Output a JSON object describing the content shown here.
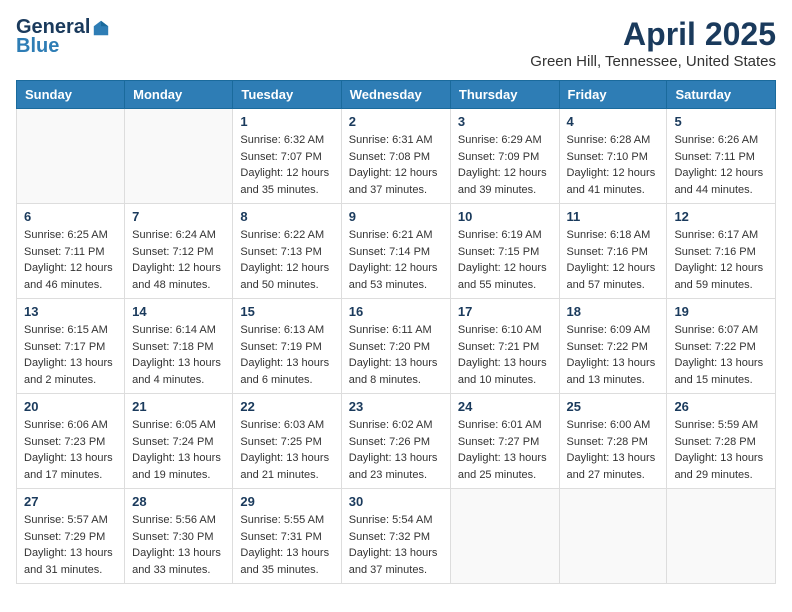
{
  "header": {
    "logo_line1": "General",
    "logo_line2": "Blue",
    "title": "April 2025",
    "subtitle": "Green Hill, Tennessee, United States"
  },
  "days_of_week": [
    "Sunday",
    "Monday",
    "Tuesday",
    "Wednesday",
    "Thursday",
    "Friday",
    "Saturday"
  ],
  "weeks": [
    [
      {
        "day": "",
        "info": ""
      },
      {
        "day": "",
        "info": ""
      },
      {
        "day": "1",
        "info": "Sunrise: 6:32 AM\nSunset: 7:07 PM\nDaylight: 12 hours and 35 minutes."
      },
      {
        "day": "2",
        "info": "Sunrise: 6:31 AM\nSunset: 7:08 PM\nDaylight: 12 hours and 37 minutes."
      },
      {
        "day": "3",
        "info": "Sunrise: 6:29 AM\nSunset: 7:09 PM\nDaylight: 12 hours and 39 minutes."
      },
      {
        "day": "4",
        "info": "Sunrise: 6:28 AM\nSunset: 7:10 PM\nDaylight: 12 hours and 41 minutes."
      },
      {
        "day": "5",
        "info": "Sunrise: 6:26 AM\nSunset: 7:11 PM\nDaylight: 12 hours and 44 minutes."
      }
    ],
    [
      {
        "day": "6",
        "info": "Sunrise: 6:25 AM\nSunset: 7:11 PM\nDaylight: 12 hours and 46 minutes."
      },
      {
        "day": "7",
        "info": "Sunrise: 6:24 AM\nSunset: 7:12 PM\nDaylight: 12 hours and 48 minutes."
      },
      {
        "day": "8",
        "info": "Sunrise: 6:22 AM\nSunset: 7:13 PM\nDaylight: 12 hours and 50 minutes."
      },
      {
        "day": "9",
        "info": "Sunrise: 6:21 AM\nSunset: 7:14 PM\nDaylight: 12 hours and 53 minutes."
      },
      {
        "day": "10",
        "info": "Sunrise: 6:19 AM\nSunset: 7:15 PM\nDaylight: 12 hours and 55 minutes."
      },
      {
        "day": "11",
        "info": "Sunrise: 6:18 AM\nSunset: 7:16 PM\nDaylight: 12 hours and 57 minutes."
      },
      {
        "day": "12",
        "info": "Sunrise: 6:17 AM\nSunset: 7:16 PM\nDaylight: 12 hours and 59 minutes."
      }
    ],
    [
      {
        "day": "13",
        "info": "Sunrise: 6:15 AM\nSunset: 7:17 PM\nDaylight: 13 hours and 2 minutes."
      },
      {
        "day": "14",
        "info": "Sunrise: 6:14 AM\nSunset: 7:18 PM\nDaylight: 13 hours and 4 minutes."
      },
      {
        "day": "15",
        "info": "Sunrise: 6:13 AM\nSunset: 7:19 PM\nDaylight: 13 hours and 6 minutes."
      },
      {
        "day": "16",
        "info": "Sunrise: 6:11 AM\nSunset: 7:20 PM\nDaylight: 13 hours and 8 minutes."
      },
      {
        "day": "17",
        "info": "Sunrise: 6:10 AM\nSunset: 7:21 PM\nDaylight: 13 hours and 10 minutes."
      },
      {
        "day": "18",
        "info": "Sunrise: 6:09 AM\nSunset: 7:22 PM\nDaylight: 13 hours and 13 minutes."
      },
      {
        "day": "19",
        "info": "Sunrise: 6:07 AM\nSunset: 7:22 PM\nDaylight: 13 hours and 15 minutes."
      }
    ],
    [
      {
        "day": "20",
        "info": "Sunrise: 6:06 AM\nSunset: 7:23 PM\nDaylight: 13 hours and 17 minutes."
      },
      {
        "day": "21",
        "info": "Sunrise: 6:05 AM\nSunset: 7:24 PM\nDaylight: 13 hours and 19 minutes."
      },
      {
        "day": "22",
        "info": "Sunrise: 6:03 AM\nSunset: 7:25 PM\nDaylight: 13 hours and 21 minutes."
      },
      {
        "day": "23",
        "info": "Sunrise: 6:02 AM\nSunset: 7:26 PM\nDaylight: 13 hours and 23 minutes."
      },
      {
        "day": "24",
        "info": "Sunrise: 6:01 AM\nSunset: 7:27 PM\nDaylight: 13 hours and 25 minutes."
      },
      {
        "day": "25",
        "info": "Sunrise: 6:00 AM\nSunset: 7:28 PM\nDaylight: 13 hours and 27 minutes."
      },
      {
        "day": "26",
        "info": "Sunrise: 5:59 AM\nSunset: 7:28 PM\nDaylight: 13 hours and 29 minutes."
      }
    ],
    [
      {
        "day": "27",
        "info": "Sunrise: 5:57 AM\nSunset: 7:29 PM\nDaylight: 13 hours and 31 minutes."
      },
      {
        "day": "28",
        "info": "Sunrise: 5:56 AM\nSunset: 7:30 PM\nDaylight: 13 hours and 33 minutes."
      },
      {
        "day": "29",
        "info": "Sunrise: 5:55 AM\nSunset: 7:31 PM\nDaylight: 13 hours and 35 minutes."
      },
      {
        "day": "30",
        "info": "Sunrise: 5:54 AM\nSunset: 7:32 PM\nDaylight: 13 hours and 37 minutes."
      },
      {
        "day": "",
        "info": ""
      },
      {
        "day": "",
        "info": ""
      },
      {
        "day": "",
        "info": ""
      }
    ]
  ]
}
